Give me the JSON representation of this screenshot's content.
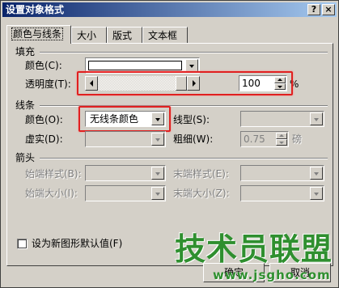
{
  "window": {
    "title": "设置对象格式",
    "help_glyph": "?",
    "close_glyph": "×"
  },
  "tabs": [
    {
      "label": "颜色与线条"
    },
    {
      "label": "大小"
    },
    {
      "label": "版式"
    },
    {
      "label": "文本框"
    }
  ],
  "fill": {
    "section_label": "填充",
    "color_label": "颜色(C):",
    "color_value": "#ffffff",
    "transparency_label": "透明度(T):",
    "transparency_value": "100",
    "transparency_level": 1.0,
    "transparency_unit": "%"
  },
  "line": {
    "section_label": "线条",
    "color_label": "颜色(O):",
    "color_value": "无线条颜色",
    "style_label": "线型(S):",
    "dashed_label": "虚实(D):",
    "weight_label": "粗细(W):",
    "weight_value": "0.75",
    "weight_unit": "磅"
  },
  "arrows": {
    "section_label": "箭头",
    "begin_style_label": "始端样式(B):",
    "end_style_label": "末端样式(E):",
    "begin_size_label": "始端大小(I):",
    "end_size_label": "末端大小(Z):"
  },
  "default_checkbox_label": "设为新图形默认值(F)",
  "buttons": {
    "ok": "确定",
    "cancel": "取消"
  },
  "watermark": {
    "text": "技术员联盟",
    "url": "www.jsgho.com"
  },
  "colors": {
    "highlight": "#e02020",
    "title_bar": "#0a246a",
    "watermark": "#2f8f2f"
  }
}
